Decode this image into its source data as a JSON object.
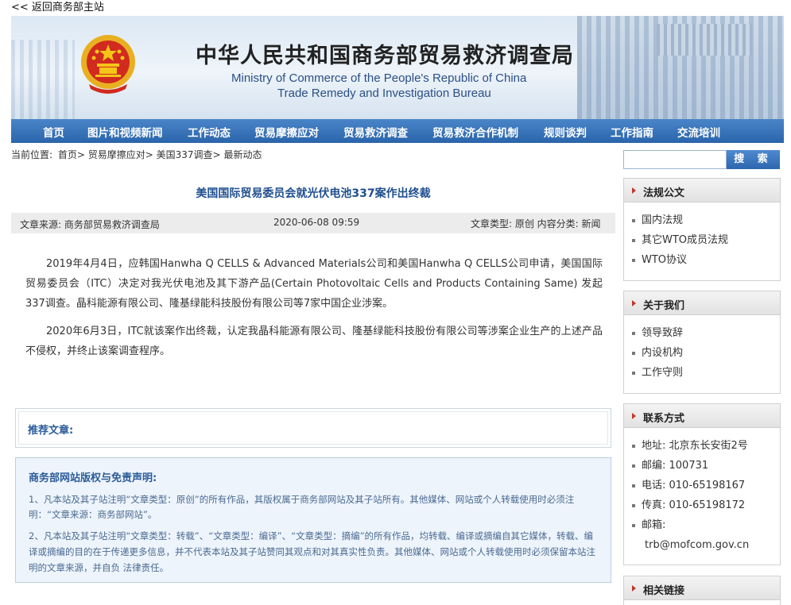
{
  "top_link": "<< 返回商务部主站",
  "header": {
    "title_cn": "中华人民共和国商务部贸易救济调查局",
    "title_en_line1": "Ministry of Commerce of the People's Republic of China",
    "title_en_line2": "Trade Remedy and Investigation Bureau"
  },
  "nav": {
    "items": [
      "首页",
      "图片和视频新闻",
      "工作动态",
      "贸易摩擦应对",
      "贸易救济调查",
      "贸易救济合作机制",
      "规则谈判",
      "工作指南",
      "交流培训"
    ]
  },
  "breadcrumb": {
    "label": "当前位置:",
    "items": [
      "首页>",
      "贸易摩擦应对>",
      "美国337调查>",
      "最新动态"
    ]
  },
  "article": {
    "title": "美国国际贸易委员会就光伏电池337案作出终裁",
    "source": "文章来源:  商务部贸易救济调查局",
    "date": "2020-06-08 09:59",
    "type": "文章类型:  原创  内容分类:  新闻",
    "paragraphs": [
      "2019年4月4日，应韩国Hanwha Q CELLS & Advanced Materials公司和美国Hanwha Q CELLS公司申请，美国国际贸易委员会（ITC）决定对我光伏电池及其下游产品(Certain Photovoltaic Cells and Products Containing Same) 发起337调查。晶科能源有限公司、隆基绿能科技股份有限公司等7家中国企业涉案。",
      "2020年6月3日，ITC就该案作出终裁，认定我晶科能源有限公司、隆基绿能科技股份有限公司等涉案企业生产的上述产品不侵权，并终止该案调查程序。"
    ]
  },
  "recommend": {
    "label": "推荐文章:"
  },
  "copyright": {
    "head": "商务部网站版权与免责声明:",
    "p1": "1、凡本站及其子站注明“文章类型：原创”的所有作品，其版权属于商务部网站及其子站所有。其他媒体、网站或个人转载使用时必须注明：“文章来源：商务部网站”。",
    "p2": "2、凡本站及其子站注明“文章类型：转载”、“文章类型：编译”、“文章类型：摘编”的所有作品，均转载、编译或摘编自其它媒体，转载、编 译或摘编的目的在于传递更多信息，并不代表本站及其子站赞同其观点和对其真实性负责。其他媒体、网站或个人转载使用时必须保留本站注明的文章来源，并自负 法律责任。"
  },
  "search": {
    "button_label": "搜 索",
    "placeholder": ""
  },
  "sidebar": {
    "regulations": {
      "title": "法规公文",
      "items": [
        "国内法规",
        "其它WTO成员法规",
        "WTO协议"
      ]
    },
    "about": {
      "title": "关于我们",
      "items": [
        "领导致辞",
        "内设机构",
        "工作守则"
      ]
    },
    "contact": {
      "title": "联系方式",
      "items": [
        "地址:  北京东长安街2号",
        "邮编:  100731",
        "电话:  010-65198167",
        "传真:  010-65198172",
        "邮箱:",
        "trb@mofcom.gov.cn"
      ]
    },
    "links": {
      "title": "相关链接"
    }
  }
}
